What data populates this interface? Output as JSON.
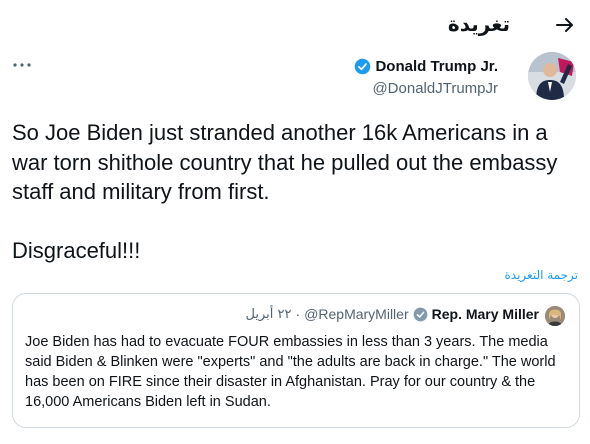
{
  "header": {
    "title": "تغريدة",
    "back_icon": "arrow-right-icon"
  },
  "tweet": {
    "author_name": "Donald Trump Jr.",
    "author_handle": "@DonaldJTrumpJr",
    "verified": true,
    "text": "So Joe Biden just stranded another 16k Americans in a war torn shithole country that he pulled out the embassy staff and military from first.\n\nDisgraceful!!!",
    "translate_label": "ترجمة التغريدة",
    "more_icon": "more-horizontal-icon"
  },
  "quote": {
    "author_name": "Rep. Mary Miller",
    "author_handle": "@RepMaryMiller",
    "separator": "·",
    "date": "٢٢ أبريل",
    "verified": true,
    "text": "Joe Biden has had to evacuate FOUR embassies in less than 3 years. The media said Biden & Blinken were \"experts\" and \"the adults are back in charge.\" The world has been on FIRE since their disaster in Afghanistan. Pray for our country & the 16,000 Americans Biden left in Sudan."
  },
  "colors": {
    "accent": "#1d9bf0",
    "text": "#0f1419",
    "secondary_text": "#536471",
    "border": "#cfd9de"
  }
}
